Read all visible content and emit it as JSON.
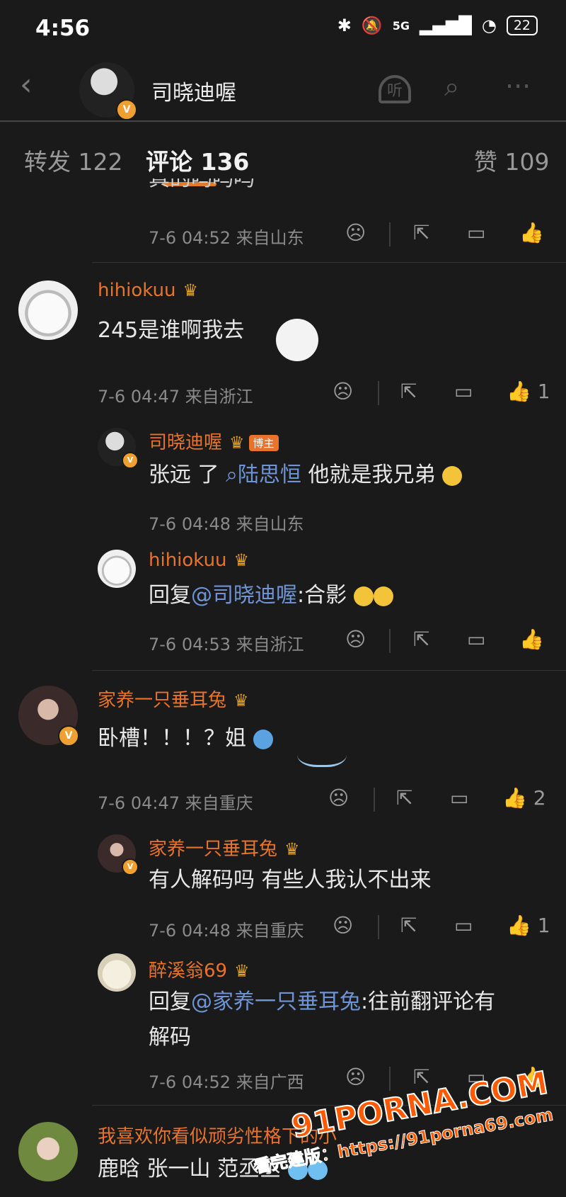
{
  "status": {
    "time": "4:56",
    "network": "5G",
    "battery": "22"
  },
  "header": {
    "title": "司晓迪喔",
    "listen_label": "听"
  },
  "tabs": [
    {
      "label": "转发 122"
    },
    {
      "label": "评论 136"
    },
    {
      "label": "赞 109"
    }
  ],
  "cut_text": "真的吗吗吗",
  "top_meta": "7-6 04:52 来自山东",
  "comments": [
    {
      "name": "hihiokuu",
      "text": "245是谁啊我去",
      "meta": "7-6 04:47 来自浙江",
      "likes": "1",
      "replies": [
        {
          "name": "司晓迪喔",
          "owner_tag": "博主",
          "text_pre": "张远 了",
          "mention": "陆思恒",
          "text_post": " 他就是我兄弟",
          "meta": "7-6 04:48 来自山东"
        },
        {
          "name": "hihiokuu",
          "text_pre": "回复",
          "mention": "@司晓迪喔",
          "text_post": ":合影",
          "meta": "7-6 04:53 来自浙江"
        }
      ]
    },
    {
      "name": "家养一只垂耳兔",
      "text": "卧槽！！！？姐",
      "meta": "7-6 04:47 来自重庆",
      "likes": "2",
      "replies": [
        {
          "name": "家养一只垂耳兔",
          "text": "有人解码吗 有些人我认不出来",
          "meta": "7-6 04:48 来自重庆",
          "likes": "1"
        },
        {
          "name": "醉溪翁69",
          "text_pre": "回复",
          "mention": "@家养一只垂耳兔",
          "text_post": ":往前翻评论有",
          "text_line2": "解码",
          "meta": "7-6 04:52 来自广西"
        }
      ]
    },
    {
      "name": "我喜欢你看似顽劣性格下的小",
      "text": "鹿晗 张一山 范丞丞"
    }
  ],
  "watermark": {
    "site": "91PORNA.COM",
    "line": "看完建版：https://91porna69.com"
  },
  "colors": {
    "accent": "#e8732c",
    "mention": "#6f94d6",
    "background": "#1a1a1a"
  }
}
